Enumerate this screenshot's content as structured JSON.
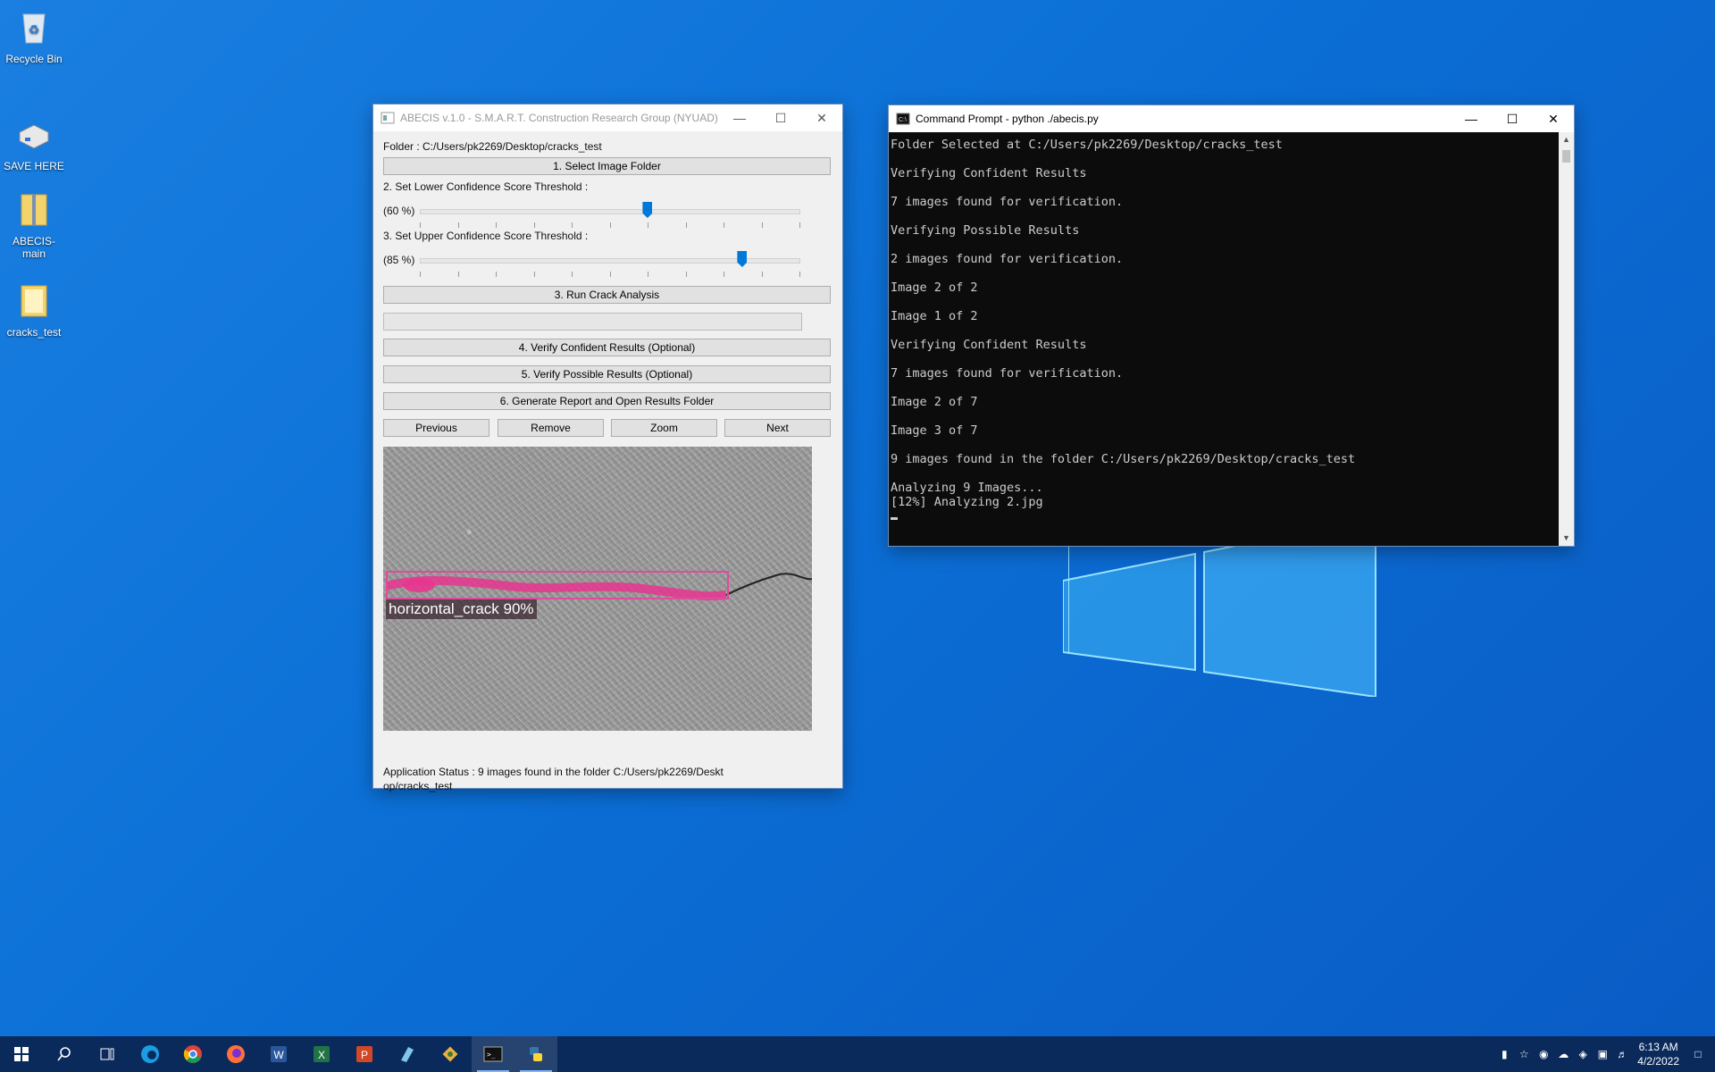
{
  "desktop": {
    "icons": [
      {
        "label": "Recycle Bin"
      },
      {
        "label": "SAVE HERE"
      },
      {
        "label": "ABECIS-main"
      },
      {
        "label": "cracks_test"
      }
    ]
  },
  "abecis": {
    "title": "ABECIS v.1.0 - S.M.A.R.T. Construction Research Group (NYUAD)",
    "folder_label": "Folder : C:/Users/pk2269/Desktop/cracks_test",
    "select_folder_btn": "1. Select Image Folder",
    "lower_label": "2. Set Lower Confidence Score Threshold :",
    "lower_value": "(60 %)",
    "lower_level": 0.6,
    "upper_label": "3. Set Upper Confidence Score Threshold :",
    "upper_value": "(85 %)",
    "upper_level": 0.85,
    "run_btn": "3. Run Crack Analysis",
    "verify_confident_btn": "4. Verify Confident Results (Optional)",
    "verify_possible_btn": "5. Verify Possible Results (Optional)",
    "generate_btn": "6. Generate Report and Open Results Folder",
    "nav": {
      "previous": "Previous",
      "remove": "Remove",
      "zoom": "Zoom",
      "next": "Next"
    },
    "detection_label": "horizontal_crack 90%",
    "status_line1": "Application Status : 9 images found in the folder C:/Users/pk2269/Deskt",
    "status_line2": "op/cracks_test"
  },
  "cmd": {
    "title": "Command Prompt - python  ./abecis.py",
    "lines": [
      "Folder Selected at C:/Users/pk2269/Desktop/cracks_test",
      "",
      "Verifying Confident Results",
      "",
      "7 images found for verification.",
      "",
      "Verifying Possible Results",
      "",
      "2 images found for verification.",
      "",
      "Image 2 of 2",
      "",
      "Image 1 of 2",
      "",
      "Verifying Confident Results",
      "",
      "7 images found for verification.",
      "",
      "Image 2 of 7",
      "",
      "Image 3 of 7",
      "",
      "9 images found in the folder C:/Users/pk2269/Desktop/cracks_test",
      "",
      "Analyzing 9 Images...",
      "[12%] Analyzing 2.jpg"
    ]
  },
  "taskbar": {
    "apps": [
      "start-icon",
      "search-icon",
      "task-view-icon",
      "edge-icon",
      "chrome-icon",
      "firefox-icon",
      "word-icon",
      "excel-icon",
      "powerpoint-icon",
      "notepad-icon",
      "git-icon",
      "cmd-icon",
      "python-icon"
    ],
    "time": "6:13 AM",
    "date": "4/2/2022"
  }
}
